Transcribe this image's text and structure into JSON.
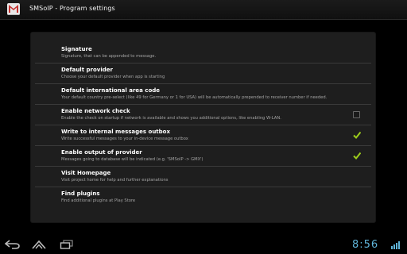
{
  "app_bar": {
    "title": "SMSoIP - Program settings"
  },
  "settings": [
    {
      "title": "Signature",
      "summary": "Signature, that can be appended to message.",
      "checkbox": null
    },
    {
      "title": "Default provider",
      "summary": "Choose your default provider when app is starting",
      "checkbox": null
    },
    {
      "title": "Default international area code",
      "summary": "Your default country pre-select (like 49 for Germany or 1 for USA) will be automatically prepended to receiver number if needed.",
      "checkbox": null
    },
    {
      "title": "Enable network check",
      "summary": "Enable the check on startup if network is available and shows you additional options, like enabling W-LAN.",
      "checkbox": false
    },
    {
      "title": "Write to internal messages outbox",
      "summary": "Write successful messages to your in-device message outbox",
      "checkbox": true
    },
    {
      "title": "Enable output of provider",
      "summary": "Messages going to database will be indicated (e.g. 'SMSoIP -> GMX')",
      "checkbox": true
    },
    {
      "title": "Visit Homepage",
      "summary": "Visit project home for help and further explanations",
      "checkbox": null
    },
    {
      "title": "Find plugins",
      "summary": "Find additional plugins at Play Store",
      "checkbox": null
    }
  ],
  "system_bar": {
    "time": "8:56",
    "nav_icons": [
      "back-icon",
      "home-icon",
      "recent-apps-icon"
    ],
    "status_icons": [
      "signal-icon"
    ]
  },
  "colors": {
    "accent_check": "#9ccc1b",
    "clock": "#5fb4d9"
  }
}
